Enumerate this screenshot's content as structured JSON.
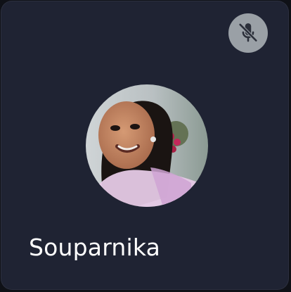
{
  "participant": {
    "name": "Souparnika",
    "mic_status": "muted"
  },
  "icons": {
    "mute_indicator": "mic-off-icon",
    "avatar": "avatar-photo"
  },
  "colors": {
    "tile_background": "#1f2333",
    "mute_badge": "#9aa0a6",
    "name_text": "#ffffff"
  }
}
